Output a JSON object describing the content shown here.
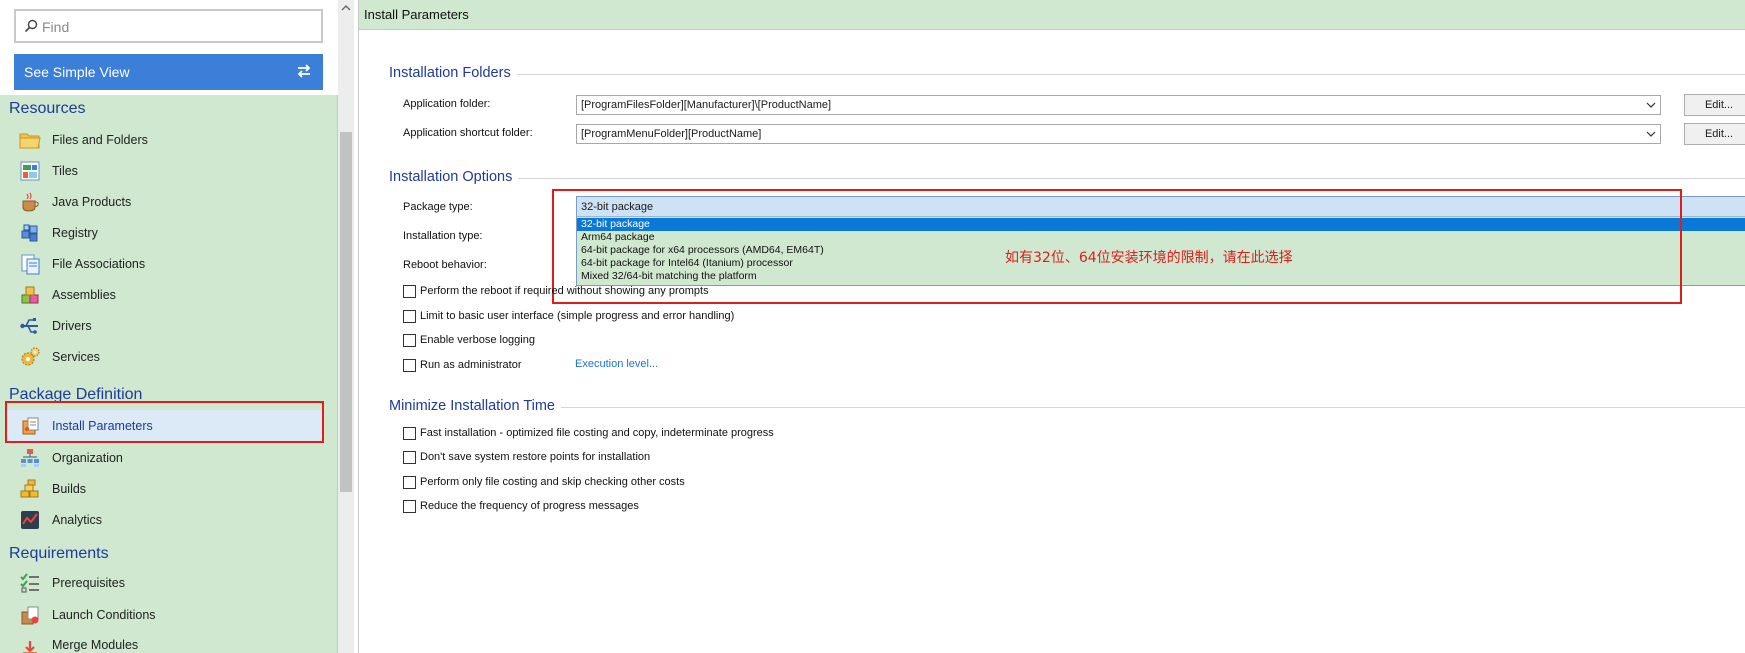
{
  "search": {
    "placeholder": "Find"
  },
  "simple_view_label": "See Simple View",
  "sidebar": {
    "sections": [
      {
        "title": "Resources"
      },
      {
        "title": "Package Definition"
      },
      {
        "title": "Requirements"
      }
    ],
    "items": [
      {
        "label": "Files and Folders",
        "icon": "folder-icon"
      },
      {
        "label": "Tiles",
        "icon": "tiles-icon"
      },
      {
        "label": "Java Products",
        "icon": "java-cup-icon"
      },
      {
        "label": "Registry",
        "icon": "registry-icon"
      },
      {
        "label": "File Associations",
        "icon": "file-association-icon"
      },
      {
        "label": "Assemblies",
        "icon": "assemblies-icon"
      },
      {
        "label": "Drivers",
        "icon": "usb-driver-icon"
      },
      {
        "label": "Services",
        "icon": "gears-icon"
      },
      {
        "label": "Install Parameters",
        "icon": "install-package-icon",
        "active": true
      },
      {
        "label": "Organization",
        "icon": "organization-tree-icon"
      },
      {
        "label": "Builds",
        "icon": "builds-bricks-icon"
      },
      {
        "label": "Analytics",
        "icon": "analytics-chart-icon"
      },
      {
        "label": "Prerequisites",
        "icon": "prerequisites-checklist-icon"
      },
      {
        "label": "Launch Conditions",
        "icon": "launch-conditions-icon"
      },
      {
        "label": "Merge Modules",
        "icon": "merge-modules-icon"
      }
    ]
  },
  "main": {
    "header": "Install Parameters",
    "installation_folders": {
      "title": "Installation Folders",
      "app_folder_label": "Application folder:",
      "app_folder_value": "[ProgramFilesFolder][Manufacturer]\\[ProductName]",
      "shortcut_folder_label": "Application shortcut folder:",
      "shortcut_folder_value": "[ProgramMenuFolder][ProductName]",
      "edit_label": "Edit..."
    },
    "installation_options": {
      "title": "Installation Options",
      "package_type_label": "Package type:",
      "installation_type_label": "Installation type:",
      "reboot_label": "Reboot behavior:",
      "package_type_selected": "32-bit package",
      "package_type_options": [
        "32-bit package",
        "Arm64 package",
        "64-bit package for x64 processors (AMD64, EM64T)",
        "64-bit package for Intel64 (Itanium) processor",
        "Mixed 32/64-bit matching the platform"
      ],
      "checks": [
        {
          "label": "Perform the reboot if required without showing any prompts",
          "checked": false
        },
        {
          "label": "Limit to basic user interface (simple progress and error handling)",
          "checked": false
        },
        {
          "label": "Enable verbose logging",
          "checked": false
        },
        {
          "label": "Run as administrator",
          "checked": false
        }
      ],
      "execution_level_link": "Execution level..."
    },
    "minimize_time": {
      "title": "Minimize Installation Time",
      "checks": [
        {
          "label": "Fast installation - optimized file costing and copy, indeterminate progress",
          "checked": false
        },
        {
          "label": "Don't save system restore points for installation",
          "checked": false
        },
        {
          "label": "Perform only file costing and skip checking other costs",
          "checked": false
        },
        {
          "label": "Reduce the frequency of progress messages",
          "checked": false
        }
      ]
    },
    "annotation": "如有32位、64位安装环境的限制，请在此选择"
  },
  "colors": {
    "accent_blue": "#3b7fd9",
    "panel_green": "#cfe8cf",
    "section_blue": "#1f3a9a",
    "annotation_red": "#e01c1c",
    "selected_option": "#0a78d7"
  }
}
